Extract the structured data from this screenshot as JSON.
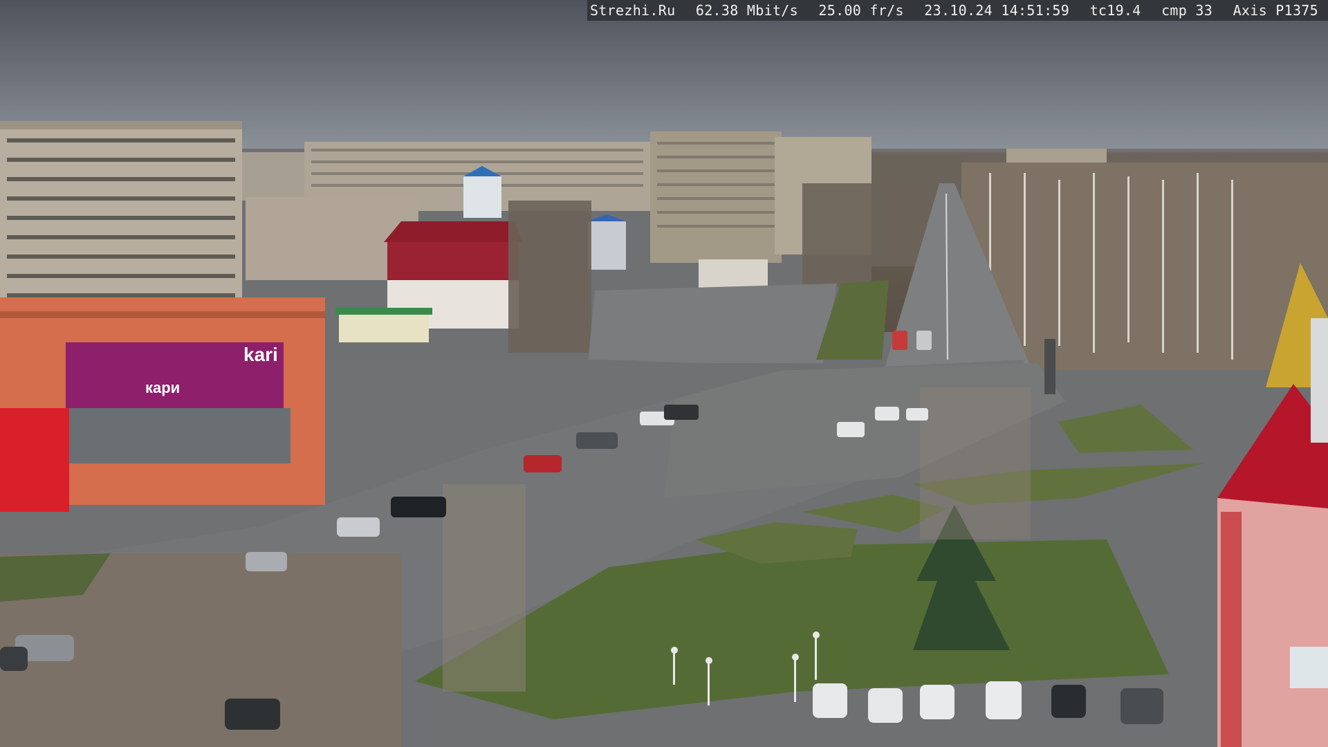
{
  "overlay": {
    "site": "Strezhi.Ru",
    "bitrate": "62.38 Mbit/s",
    "fps": "25.00 fr/s",
    "datetime": "23.10.24 14:51:59",
    "tc": "tc19.4",
    "cmp": "cmp 33",
    "camera": "Axis P1375"
  },
  "signs": {
    "store_main": "kari",
    "store_side": "кари"
  },
  "colors": {
    "sky": "#5b6068",
    "road": "#767879",
    "grass": "#556b35",
    "building_panel": "#b8ae9f",
    "store_orange": "#d46e4d",
    "store_magenta": "#8e1f6a",
    "roof_red": "#b5162a",
    "tree_gold": "#c9a431"
  }
}
